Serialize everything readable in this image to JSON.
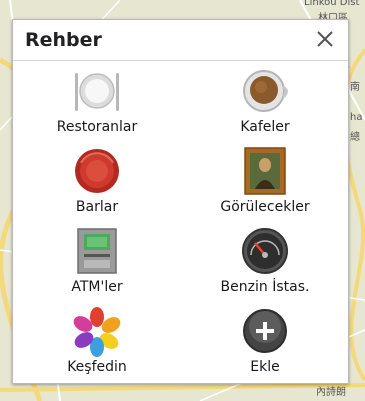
{
  "map": {
    "labels": [
      "Linkou Dist",
      "林口區",
      "林口區",
      "斗",
      "南",
      "ha",
      "總",
      "內詩朗"
    ]
  },
  "dialog": {
    "title": "Rehber",
    "close_icon": "close-icon",
    "items": [
      {
        "label": "Restoranlar",
        "icon": "plate-cutlery-icon"
      },
      {
        "label": "Kafeler",
        "icon": "coffee-cup-icon"
      },
      {
        "label": "Barlar",
        "icon": "bottle-cap-icon"
      },
      {
        "label": "Görülecekler",
        "icon": "framed-painting-icon"
      },
      {
        "label": "ATM'ler",
        "icon": "atm-machine-icon"
      },
      {
        "label": "Benzin İstas.",
        "icon": "fuel-gauge-icon"
      },
      {
        "label": "Keşfedin",
        "icon": "explore-flower-icon"
      },
      {
        "label": "Ekle",
        "icon": "add-plus-icon"
      }
    ]
  },
  "colors": {
    "map_bg": "#ece6d6",
    "road_yellow": "#f4d97a",
    "road_white": "#ffffff",
    "bar_red": "#c8322a",
    "add_gray": "#4a4a4a"
  }
}
